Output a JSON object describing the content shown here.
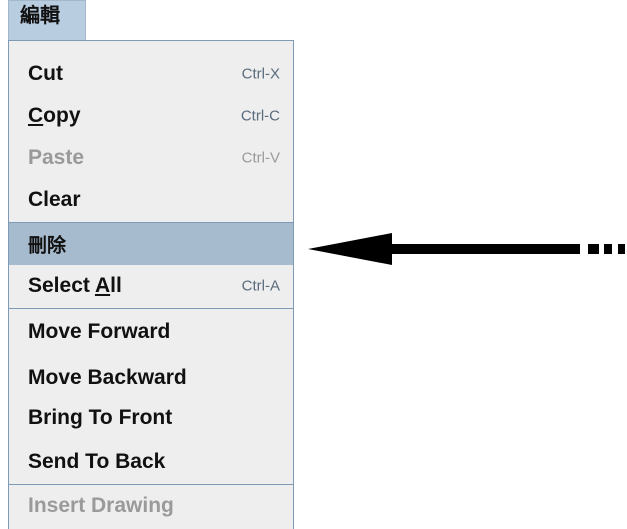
{
  "menu": {
    "title": "編輯",
    "items": [
      {
        "label": "Cut",
        "accel": "Ctrl-X",
        "disabled": false
      },
      {
        "label_mn": "C",
        "label_rest": "opy",
        "accel": "Ctrl-C",
        "disabled": false
      },
      {
        "label": "Paste",
        "accel": "Ctrl-V",
        "disabled": true
      },
      {
        "label": "Clear",
        "accel": "",
        "disabled": false
      },
      {
        "label": "刪除",
        "accel": "",
        "disabled": false,
        "highlighted": true
      },
      {
        "label_pre": "Select ",
        "label_mn": "A",
        "label_rest": "ll",
        "accel": "Ctrl-A",
        "disabled": false
      },
      {
        "label": "Move Forward",
        "accel": "",
        "disabled": false
      },
      {
        "label": "Move Backward",
        "accel": "",
        "disabled": false
      },
      {
        "label": "Bring To Front",
        "accel": "",
        "disabled": false
      },
      {
        "label": "Send To Back",
        "accel": "",
        "disabled": false
      },
      {
        "label": "Insert Drawing",
        "accel": "",
        "disabled": true
      }
    ]
  },
  "annotation": {
    "icon": "arrow-pointing-left-icon"
  },
  "colors": {
    "highlight": "#a7bbce",
    "menu_background": "#eeeeee",
    "border": "#7e9ab5",
    "disabled_text": "#9a9a9a"
  }
}
